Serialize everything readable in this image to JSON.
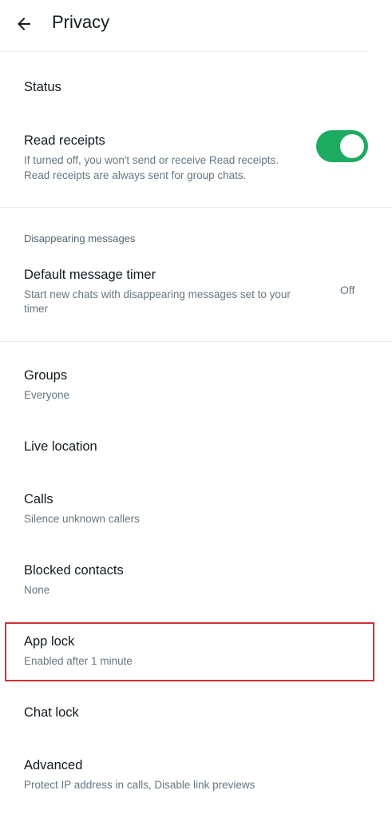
{
  "header": {
    "title": "Privacy",
    "back_icon": "arrow-left-icon"
  },
  "status": {
    "title": "Status"
  },
  "read_receipts": {
    "title": "Read receipts",
    "subtitle_line1": "If turned off, you won't send or receive Read receipts.",
    "subtitle_line2": "Read receipts are always sent for group chats.",
    "toggle_on": true,
    "toggle_color": "#1daa61"
  },
  "disappearing": {
    "section_header": "Disappearing messages",
    "title": "Default message timer",
    "subtitle_line1": "Start new chats with disappearing messages set to your",
    "subtitle_line2": "timer",
    "value": "Off"
  },
  "groups": {
    "title": "Groups",
    "subtitle": "Everyone"
  },
  "live_location": {
    "title": "Live location"
  },
  "calls": {
    "title": "Calls",
    "subtitle": "Silence unknown callers"
  },
  "blocked": {
    "title": "Blocked contacts",
    "subtitle": "None"
  },
  "app_lock": {
    "title": "App lock",
    "subtitle": "Enabled after 1 minute",
    "highlight_color": "#d32f3a"
  },
  "chat_lock": {
    "title": "Chat lock"
  },
  "advanced": {
    "title": "Advanced",
    "subtitle": "Protect IP address in calls, Disable link previews"
  }
}
